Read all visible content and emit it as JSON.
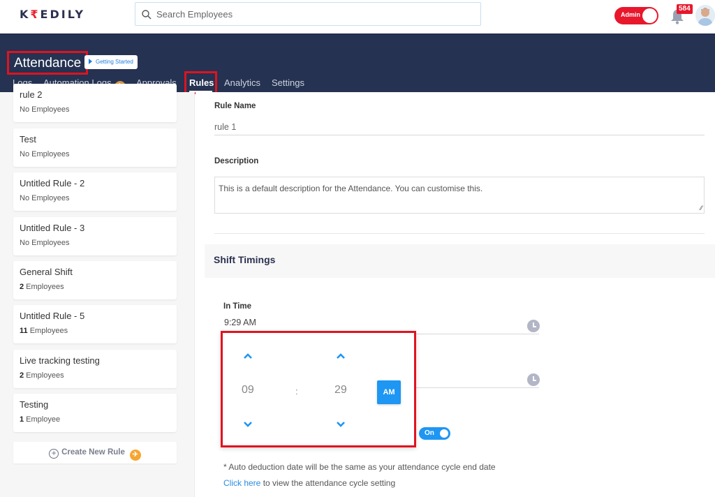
{
  "app": {
    "logo_left": "K",
    "logo_rupee": "₹",
    "logo_right": "EDILY",
    "search_placeholder": "Search Employees",
    "admin_label": "Admin",
    "notification_count": "584"
  },
  "header": {
    "title": "Attendance",
    "getting_started": "Getting Started",
    "tabs": [
      {
        "label": "Logs"
      },
      {
        "label": "Automation Logs"
      },
      {
        "label": "Approvals"
      },
      {
        "label": "Rules",
        "active": true
      },
      {
        "label": "Analytics"
      },
      {
        "label": "Settings"
      }
    ]
  },
  "sidebar": {
    "rules": [
      {
        "name": "rule 2",
        "count": "",
        "suffix": "No Employees"
      },
      {
        "name": "Test",
        "count": "",
        "suffix": "No Employees"
      },
      {
        "name": "Untitled Rule - 2",
        "count": "",
        "suffix": "No Employees"
      },
      {
        "name": "Untitled Rule - 3",
        "count": "",
        "suffix": "No Employees"
      },
      {
        "name": "General Shift",
        "count": "2",
        "suffix": " Employees"
      },
      {
        "name": "Untitled Rule - 5",
        "count": "11",
        "suffix": " Employees"
      },
      {
        "name": "Live tracking testing",
        "count": "2",
        "suffix": " Employees"
      },
      {
        "name": "Testing",
        "count": "1",
        "suffix": " Employee"
      }
    ],
    "create_label": "Create New Rule"
  },
  "form": {
    "rule_name_label": "Rule Name",
    "rule_name_value": "rule 1",
    "description_label": "Description",
    "description_value": "This is a default description for the Attendance. You can customise this.",
    "section_title": "Shift Timings",
    "in_time_label": "In Time",
    "in_time_value": "9:29 AM",
    "picker": {
      "hour": "09",
      "separator": ":",
      "minute": "29",
      "period": "AM"
    },
    "toggle_label": "On",
    "note": "* Auto deduction date will be the same as your attendance cycle end date",
    "link_text": "Click here",
    "link_suffix": " to view the attendance cycle setting"
  },
  "colors": {
    "header_bg": "#253252",
    "accent_blue": "#1e96f3",
    "highlight_red": "#e0131f",
    "admin_red": "#e8172c"
  }
}
